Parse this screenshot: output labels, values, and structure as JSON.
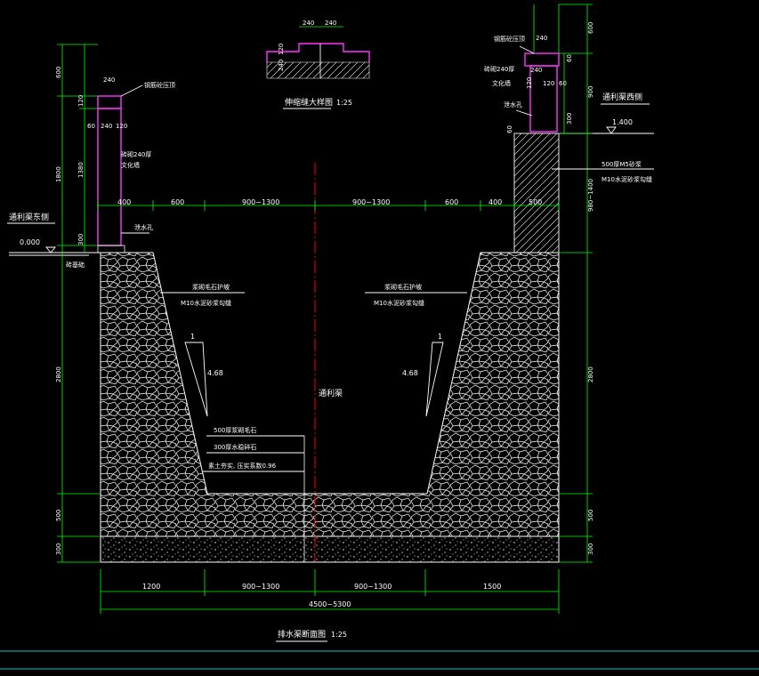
{
  "title": {
    "main": "排水渠断面图",
    "scale": "1:25"
  },
  "detail": {
    "title": "伸缩缝大样图",
    "scale": "1:25",
    "dims_top": [
      "240",
      "240"
    ],
    "dims_side": [
      "120",
      "240"
    ]
  },
  "labels": {
    "east_side": "通利渠东侧",
    "west_side": "通利渠西侧",
    "channel": "通利渠",
    "elev_left": "0.000",
    "elev_right": "1.400",
    "cap_left": "钢筋砼压顶",
    "wall_left": "砖砌240厚",
    "wall_left2": "文化墙",
    "drain_left": "泄水孔",
    "footing_left": "砖基础",
    "cap_right": "钢筋砼压顶",
    "wall_right": "砖砌240厚",
    "wall_right2": "文化墙",
    "drain_right": "泄水孔",
    "rubble_right1": "500厚M5砂浆",
    "rubble_right2": "M10水泥砂浆勾缝",
    "slope_left1": "浆砌毛石护坡",
    "slope_left2": "M10水泥砂浆勾缝",
    "slope_right1": "浆砌毛石护坡",
    "slope_right2": "M10水泥砂浆勾缝",
    "ratio_left_1": "1",
    "ratio_left_2": "4.68",
    "ratio_right_1": "1",
    "ratio_right_2": "4.68",
    "layer1": "500厚浆砌毛石",
    "layer2": "300厚水稳碎石",
    "layer3": "素土夯实, 压实系数0.96"
  },
  "dims": {
    "top_row": [
      "400",
      "600",
      "900~1300",
      "900~1300",
      "600",
      "400",
      "500"
    ],
    "bottom_row": [
      "1200",
      "900~1300",
      "900~1300",
      "1500"
    ],
    "total": "4500~5300",
    "left_vertical": [
      "600",
      "120",
      "1800",
      "1380",
      "300",
      "2800",
      "500",
      "300"
    ],
    "left_wall_top": [
      "240",
      "60",
      "240",
      "120"
    ],
    "right_vertical": [
      "600",
      "900",
      "980~1400",
      "2800",
      "500",
      "300"
    ],
    "right_wall_top": [
      "240",
      "120",
      "60",
      "240",
      "60",
      "120",
      "300",
      "60"
    ]
  },
  "colors": {
    "background": "#000000",
    "dimension": "#00ff00",
    "outline": "#ffffff",
    "wall": "#ff33ff",
    "centerline": "#ff0000",
    "border": "#00cccc"
  }
}
